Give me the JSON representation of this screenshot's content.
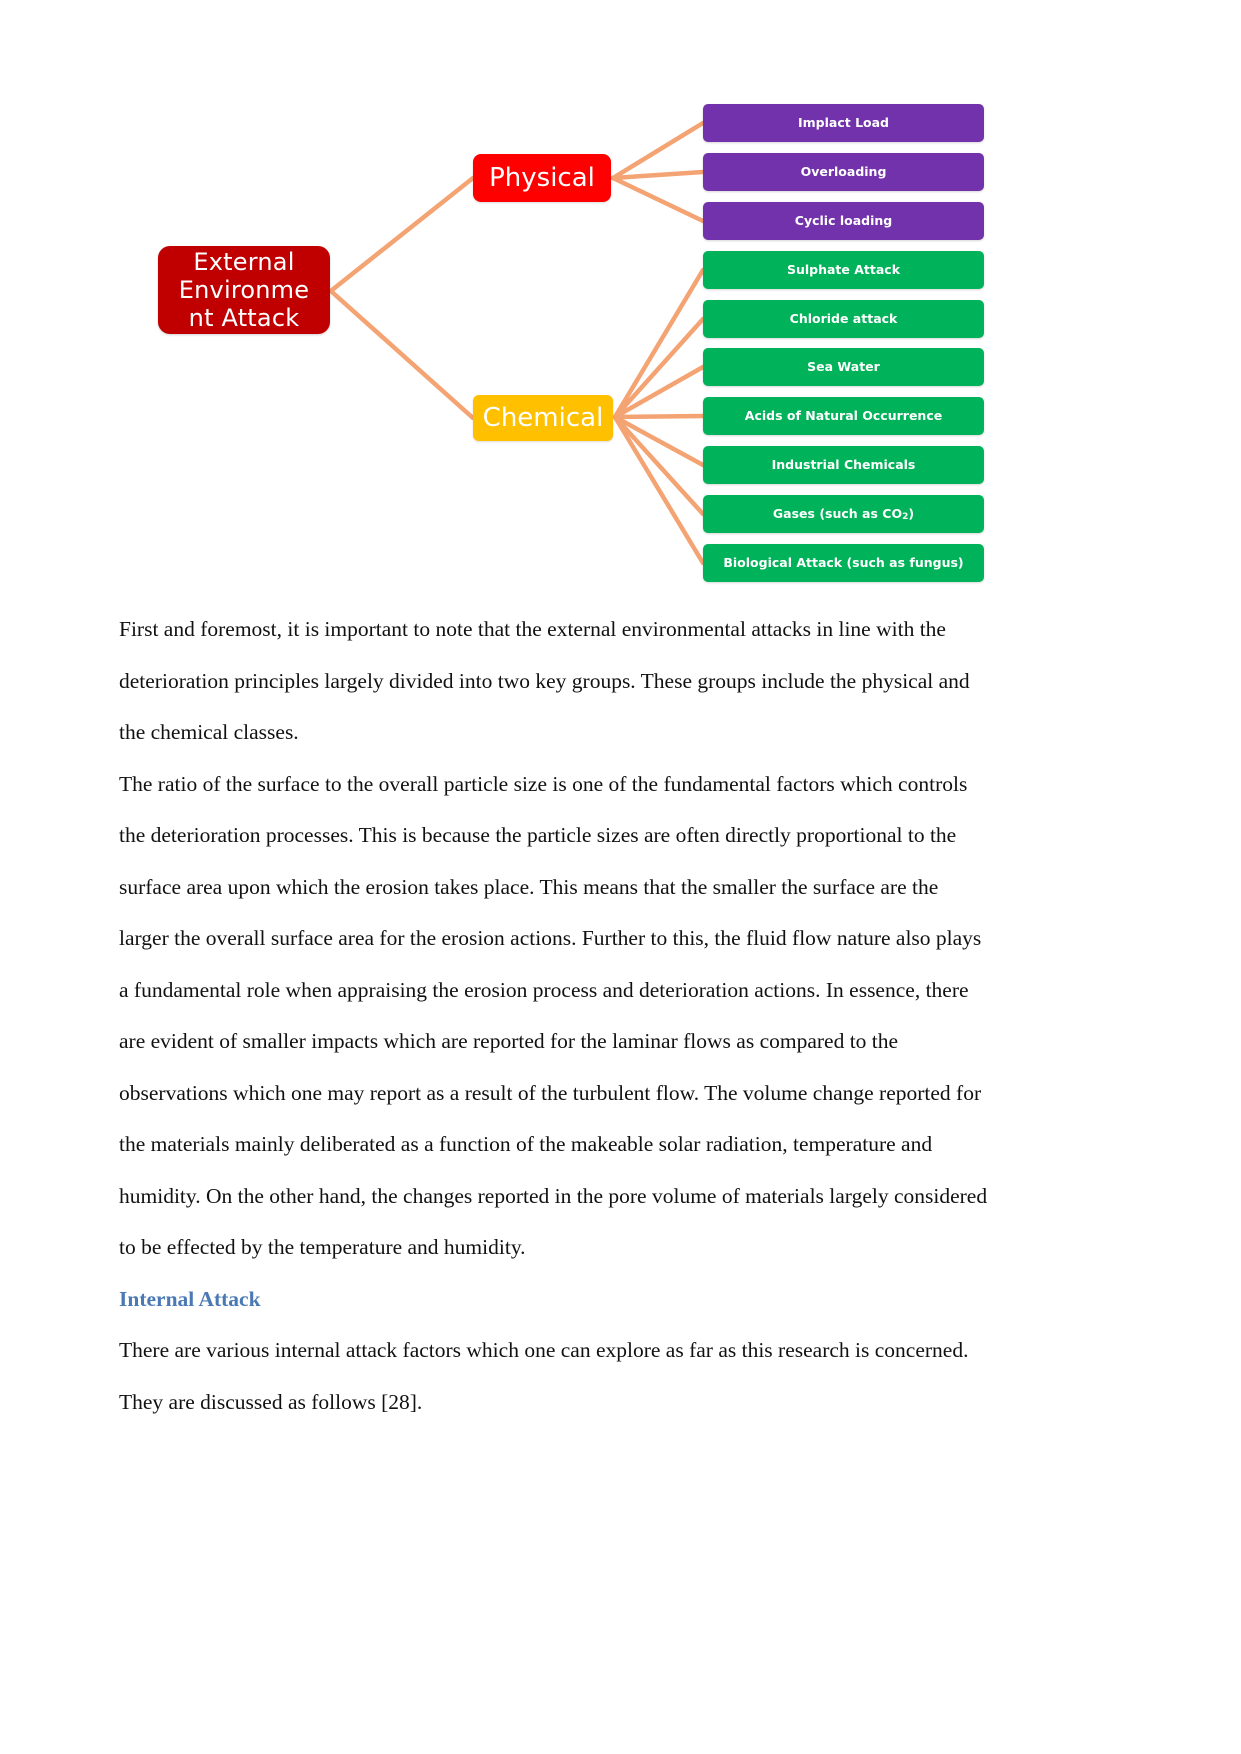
{
  "document": {
    "type": "academic-report-page",
    "background_color": "#ffffff"
  },
  "diagram": {
    "title": "External Environment Attack mind map",
    "connector_color": "#F4A373",
    "root": {
      "label": "External Environme nt  Attack",
      "line1": "External",
      "line2": "Environme",
      "line3": "nt  Attack",
      "color": "#C00000",
      "text_color": "#ffffff"
    },
    "branches": [
      {
        "label": "Physical",
        "color": "#FF0000",
        "text_color": "#ffffff",
        "leaf_color": "#7232AB",
        "leaves": [
          {
            "label": "Implact Load"
          },
          {
            "label": "Overloading"
          },
          {
            "label": "Cyclic loading"
          }
        ]
      },
      {
        "label": "Chemical",
        "color": "#FFC000",
        "text_color": "#ffffff",
        "leaf_color": "#00B259",
        "leaves": [
          {
            "label": "Sulphate Attack"
          },
          {
            "label": "Chloride attack"
          },
          {
            "label": "Sea Water"
          },
          {
            "label": "Acids of Natural Occurrence"
          },
          {
            "label": "Industrial Chemicals"
          },
          {
            "label": "Gases (such as CO2)",
            "html": "Gases (such as CO<sub>2</sub>)"
          },
          {
            "label": "Biological Attack (such as fungus)"
          }
        ]
      }
    ]
  },
  "content": {
    "paragraph_1": "First and foremost, it is important to note that the external environmental attacks in line with the deterioration principles largely divided into two key groups. These groups include the physical and the chemical classes.",
    "paragraph_2": "The ratio of the surface to the overall particle size is one of the fundamental factors which controls the deterioration processes. This is because the particle sizes are often directly proportional to the surface area upon which the erosion takes place. This means that the smaller the surface are the larger the overall surface area for the erosion actions. Further to this, the fluid flow nature also plays a fundamental role when appraising the erosion process and deterioration actions. In essence, there are evident of smaller impacts which are reported for the laminar flows as compared to the observations which one may report as a result of the turbulent flow. The volume change reported for the materials mainly deliberated as a function of the makeable solar radiation, temperature and humidity.  On the other hand, the changes reported in the pore volume of materials largely considered to be effected by the temperature and humidity.",
    "heading_internal_attack": "Internal Attack",
    "heading_color": "#4a79b4",
    "paragraph_3": "There are various internal attack factors which one can explore as far as this research is concerned. They are discussed as follows [28]."
  }
}
